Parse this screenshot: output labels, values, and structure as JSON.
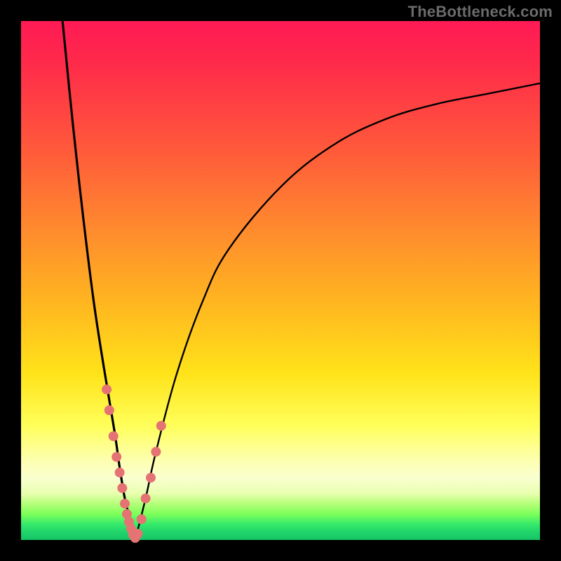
{
  "watermark": "TheBottleneck.com",
  "colors": {
    "curve_stroke": "#000000",
    "marker_fill": "#e67373",
    "marker_stroke": "#c95858"
  },
  "chart_data": {
    "type": "line",
    "title": "",
    "xlabel": "",
    "ylabel": "",
    "xlim": [
      0,
      100
    ],
    "ylim": [
      0,
      100
    ],
    "note": "Bottleneck-style V-curve. x is relative GPU/CPU capability (0–100), y is bottleneck percentage (0=green, 100=red). Values estimated from gradient position and curve shape; no axis ticks are shown in the source image.",
    "series": [
      {
        "name": "left-branch",
        "x": [
          8,
          10,
          12,
          14,
          16,
          18,
          19,
          20,
          21,
          22
        ],
        "y": [
          100,
          80,
          62,
          46,
          33,
          21,
          14,
          8,
          4,
          0
        ]
      },
      {
        "name": "right-branch",
        "x": [
          22,
          24,
          26,
          30,
          35,
          40,
          50,
          60,
          70,
          80,
          90,
          100
        ],
        "y": [
          0,
          8,
          17,
          32,
          46,
          56,
          68,
          76,
          81,
          84,
          86,
          88
        ]
      }
    ],
    "markers": {
      "name": "sample-points",
      "x": [
        16.5,
        17.0,
        17.8,
        18.4,
        19.0,
        19.5,
        20.0,
        20.4,
        20.8,
        21.2,
        21.6,
        22.0,
        22.5,
        23.2,
        24.0,
        25.0,
        26.0,
        27.0
      ],
      "y": [
        29,
        25,
        20,
        16,
        13,
        10,
        7,
        5,
        3.5,
        2.2,
        1.0,
        0.4,
        1.2,
        4.0,
        8.0,
        12.0,
        17.0,
        22.0
      ]
    }
  }
}
